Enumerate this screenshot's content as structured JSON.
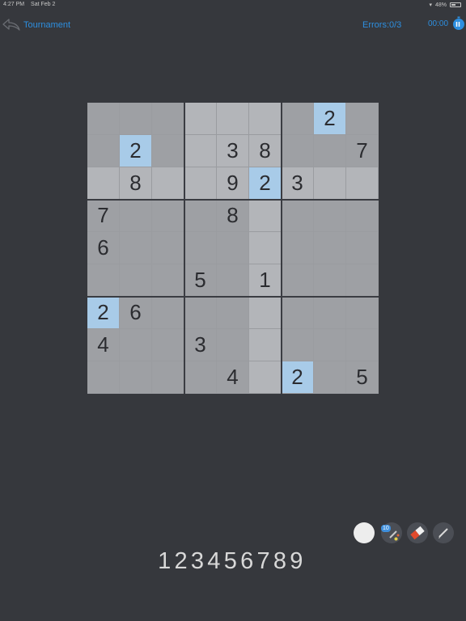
{
  "status_bar": {
    "time": "4:27 PM",
    "date": "Sat Feb 2",
    "battery_text": "48%",
    "battery_level": 0.48
  },
  "header": {
    "back_label": "Tournament",
    "errors_text": "Errors:0/3",
    "timer_text": "00:00",
    "back_icon": "curved-back-arrow-icon",
    "pause_icon": "stopwatch-icon"
  },
  "board": {
    "rows": [
      [
        "",
        "",
        "",
        "",
        "",
        "",
        "",
        "2",
        ""
      ],
      [
        "",
        "2",
        "",
        "",
        "3",
        "8",
        "",
        "",
        "7"
      ],
      [
        "",
        "8",
        "",
        "",
        "9",
        "2",
        "3",
        "",
        ""
      ],
      [
        "7",
        "",
        "",
        "",
        "8",
        "",
        "",
        "",
        ""
      ],
      [
        "6",
        "",
        "",
        "",
        "",
        "",
        "",
        "",
        ""
      ],
      [
        "",
        "",
        "",
        "5",
        "",
        "1",
        "",
        "",
        ""
      ],
      [
        "2",
        "6",
        "",
        "",
        "",
        "",
        "",
        "",
        ""
      ],
      [
        "4",
        "",
        "",
        "3",
        "",
        "",
        "",
        "",
        ""
      ],
      [
        "",
        "",
        "",
        "",
        "4",
        "",
        "2",
        "",
        "5"
      ]
    ],
    "selected_cell": {
      "row": 2,
      "col": 5
    },
    "highlighted_digit": "2"
  },
  "tools": [
    {
      "name": "color-dot-tool",
      "icon": "white-circle-icon"
    },
    {
      "name": "hint-tool",
      "icon": "magic-wand-icon",
      "badge": "10"
    },
    {
      "name": "eraser-tool",
      "icon": "eraser-icon"
    },
    {
      "name": "pencil-tool",
      "icon": "pencil-icon"
    }
  ],
  "number_pad": [
    "1",
    "2",
    "3",
    "4",
    "5",
    "6",
    "7",
    "8",
    "9"
  ],
  "colors": {
    "background": "#36383d",
    "accent": "#2d8fe0",
    "cell_normal": "#9ea0a4",
    "cell_related": "#b3b5b9",
    "cell_highlight": "#a8cbe8",
    "cell_text": "#2b2c30"
  }
}
